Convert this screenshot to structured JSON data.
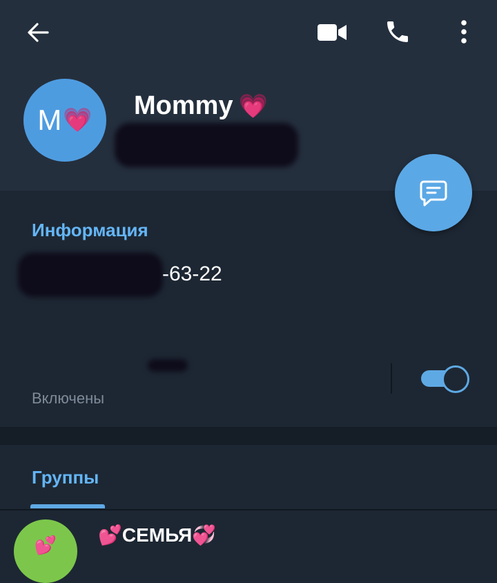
{
  "header": {
    "contact_name": "Mommy",
    "name_emoji": "💗",
    "avatar_letter": "M",
    "avatar_emoji": "💗",
    "icons": [
      "back-arrow-icon",
      "video-call-icon",
      "phone-icon",
      "more-vertical-icon",
      "message-icon"
    ]
  },
  "info": {
    "section_title": "Информация",
    "phone_visible": "-63-22",
    "notifications_status": "Включены",
    "notifications_enabled": true
  },
  "groups": {
    "tab_title": "Группы",
    "items": [
      {
        "prefix_emoji": "💕",
        "name": "СЕМЬЯ",
        "suffix_emoji": "💞",
        "avatar_emoji": "💕"
      }
    ]
  },
  "colors": {
    "header_bg": "#242f3d",
    "body_bg": "#1d2733",
    "accent": "#64b5f6",
    "fab": "#5ba8e6",
    "avatar": "#4e9ce0",
    "group_avatar": "#7cc74b"
  }
}
